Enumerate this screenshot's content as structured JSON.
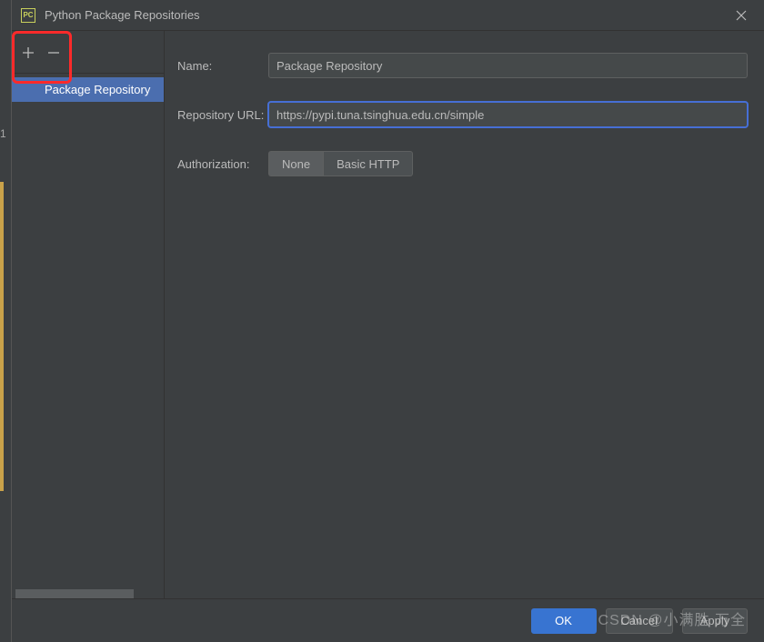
{
  "backdrop": {
    "token": "1"
  },
  "titlebar": {
    "icon_text": "PC",
    "title": "Python Package Repositories"
  },
  "sidebar": {
    "items": [
      {
        "label": "Package Repository"
      }
    ]
  },
  "form": {
    "name_label": "Name:",
    "name_value": "Package Repository",
    "url_label": "Repository URL:",
    "url_value": "https://pypi.tuna.tsinghua.edu.cn/simple",
    "auth_label": "Authorization:",
    "auth_none": "None",
    "auth_basic": "Basic HTTP"
  },
  "footer": {
    "ok": "OK",
    "cancel": "Cancel",
    "apply": "Apply"
  },
  "watermark": "CSDN @小满胜 万全"
}
